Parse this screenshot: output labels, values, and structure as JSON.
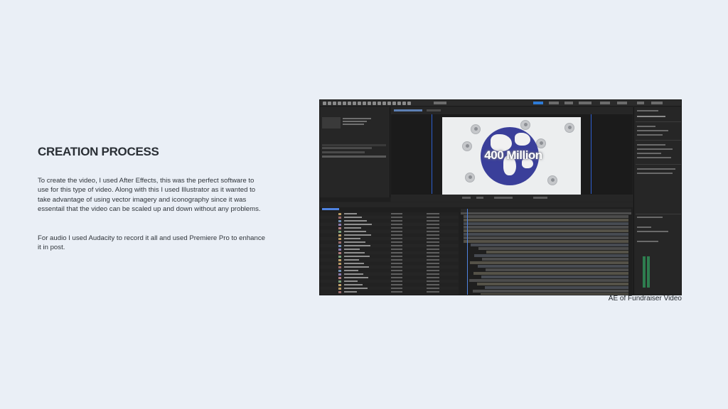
{
  "slide": {
    "heading": "CREATION PROCESS",
    "paragraph1": "To create the video, I used After Effects, this was the perfect software to use for this type of video. Along with this I used Illustrator as it wanted to take advantage of using vector imagery and iconography since it was essentail that the video can be scaled up and down without any problems.",
    "paragraph2": "For audio I used Audacity to record it all and used Premiere Pro to enhance it in post.",
    "caption": "AE of Fundraiser Video"
  },
  "screenshot": {
    "app": "After Effects",
    "composition_text": "400 Million"
  },
  "colors": {
    "background": "#eaeff6",
    "ae_panel": "#232323",
    "ae_accent": "#2e7bd6",
    "globe": "#3a3f9a"
  }
}
